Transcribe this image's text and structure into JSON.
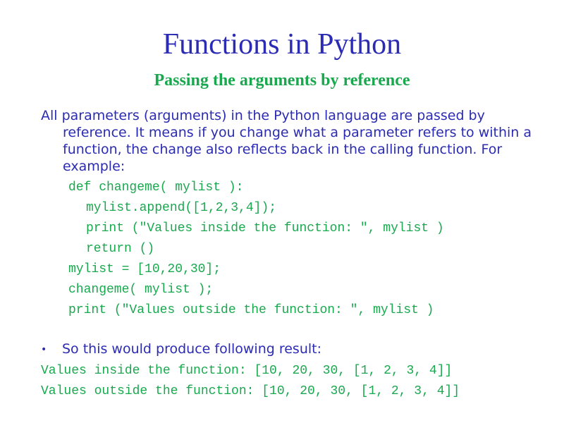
{
  "slide": {
    "title": "Functions in Python",
    "subtitle": "Passing the arguments by reference",
    "intro_paragraph": "All parameters (arguments) in the Python language are passed by reference. It means if you change what a parameter refers to within a function, the change also reflects back in the calling function. For example:",
    "code_lines": [
      "def changeme( mylist ):",
      "mylist.append([1,2,3,4]);",
      "print (\"Values inside the function: \", mylist )",
      "return ()",
      "mylist = [10,20,30];",
      "changeme( mylist );",
      "print (\"Values outside the function: \", mylist )"
    ],
    "bullet_symbol": "•",
    "bullet_text": "So this would produce following result:",
    "output_lines": [
      "Values inside the function: [10, 20, 30, [1, 2, 3, 4]]",
      "Values outside the function: [10, 20, 30, [1, 2, 3, 4]]"
    ]
  },
  "colors": {
    "title": "#2b2bb3",
    "subtitle": "#1aa84f",
    "body_text": "#2b2bb3",
    "code": "#1aa84f",
    "background": "#ffffff"
  }
}
